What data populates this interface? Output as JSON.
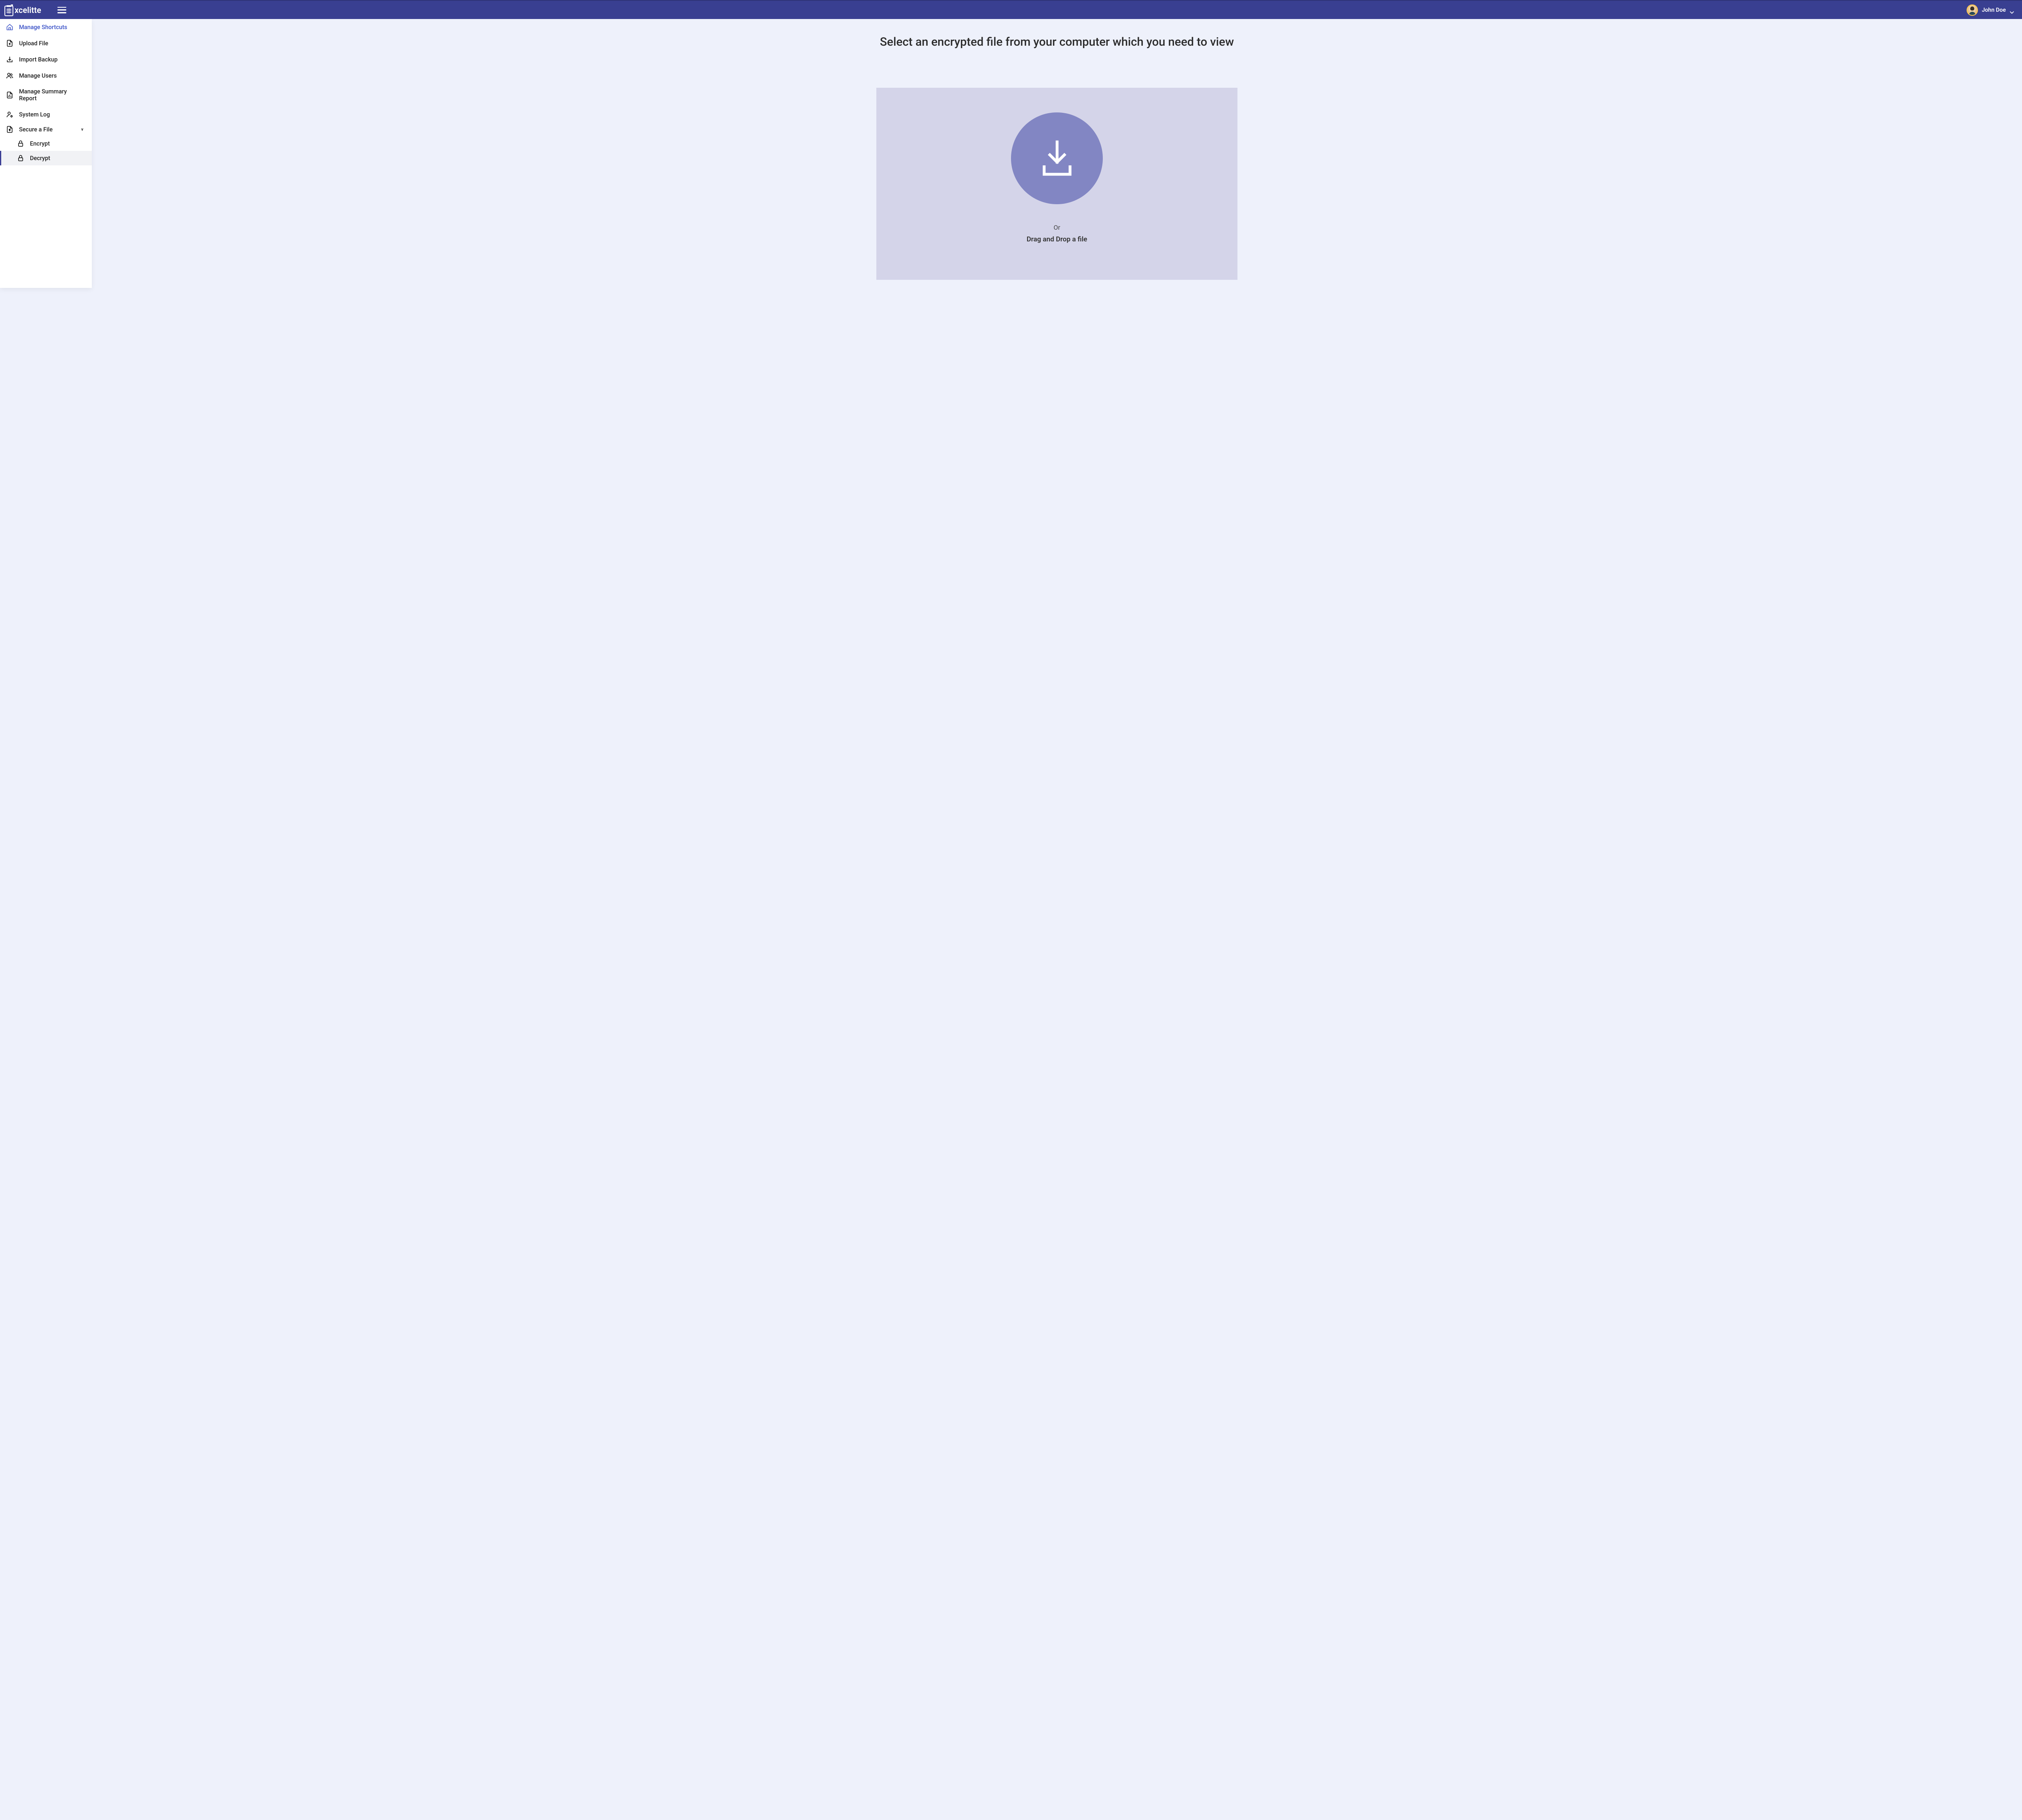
{
  "header": {
    "brand_name": "xcelitte",
    "user_name": "John Doe"
  },
  "sidebar": {
    "items": [
      {
        "label": "Manage Shortcuts",
        "icon": "home-icon",
        "highlighted": true
      },
      {
        "label": "Upload File",
        "icon": "file-up-icon"
      },
      {
        "label": "Import Backup",
        "icon": "import-icon"
      },
      {
        "label": "Manage Users",
        "icon": "users-icon"
      },
      {
        "label": "Manage Summary Report",
        "icon": "report-icon"
      },
      {
        "label": "System Log",
        "icon": "user-gear-icon"
      },
      {
        "label": "Secure a File",
        "icon": "file-lock-icon",
        "expandable": true,
        "expanded": true
      }
    ],
    "subitems": [
      {
        "label": "Encrypt",
        "icon": "lock-icon"
      },
      {
        "label": "Decrypt",
        "icon": "lock-icon",
        "active": true
      }
    ]
  },
  "main": {
    "title": "Select an encrypted file from your computer which you need to view",
    "or_text": "Or",
    "drag_text": "Drag and Drop a file"
  }
}
